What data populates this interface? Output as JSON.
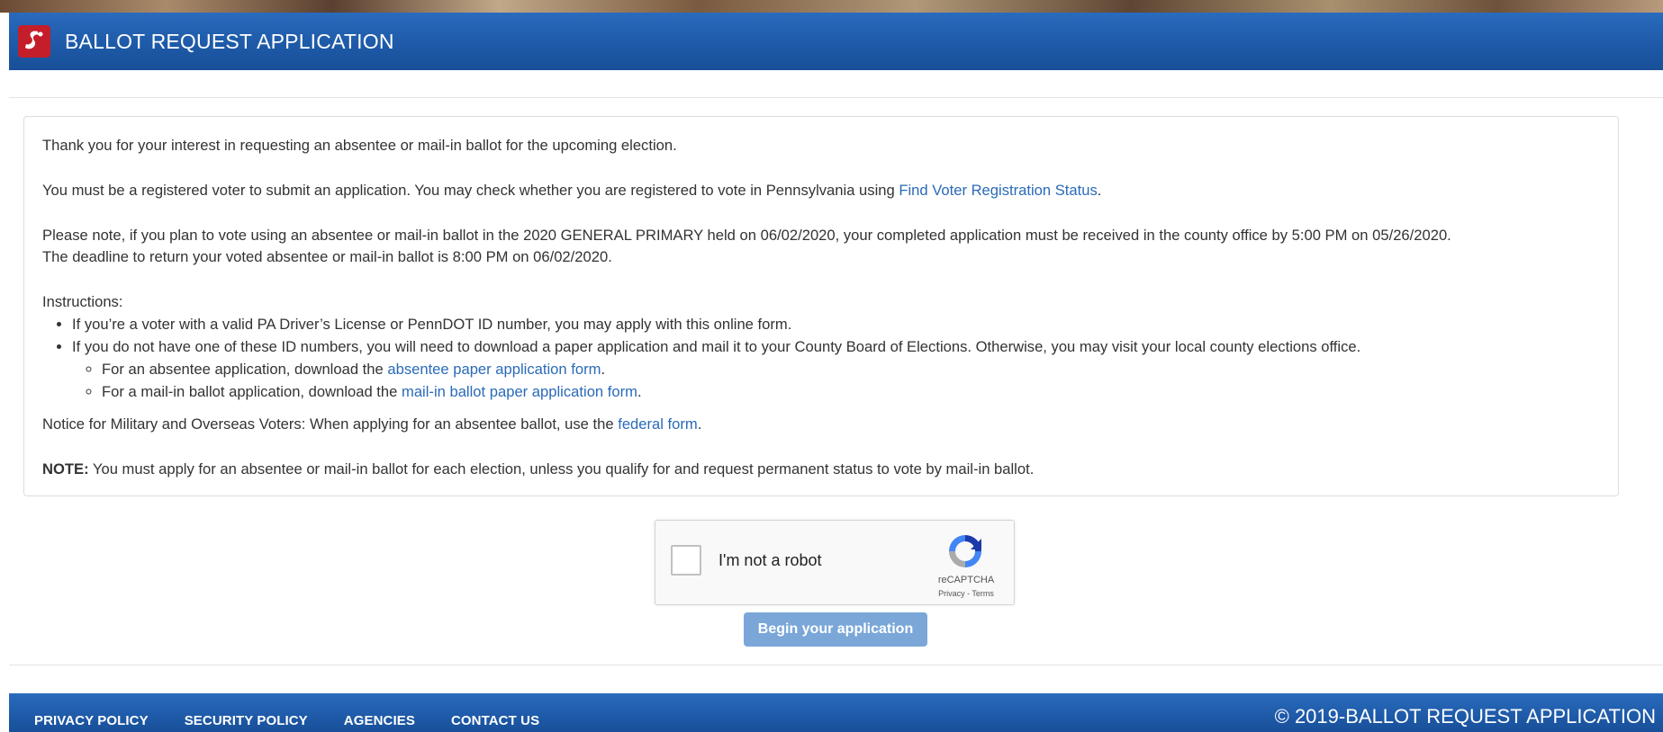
{
  "header": {
    "title": "BALLOT REQUEST APPLICATION"
  },
  "intro": {
    "thanks": "Thank you for your interest in requesting an absentee or mail-in ballot for the upcoming election.",
    "registered_prefix": "You must be a registered voter to submit an application. You may check whether you are registered to vote in Pennsylvania using ",
    "registered_link": "Find Voter Registration Status",
    "registered_suffix": ".",
    "deadline_line1": "Please note, if you plan to vote using an absentee or mail-in ballot in the 2020 GENERAL PRIMARY held on 06/02/2020, your completed application must be received in the county office by 5:00 PM on 05/26/2020.",
    "deadline_line2": "The deadline to return your voted absentee or mail-in ballot is 8:00 PM on 06/02/2020."
  },
  "instructions": {
    "heading": "Instructions:",
    "item1": "If you’re a voter with a valid PA Driver’s License or PennDOT ID number, you may apply with this online form.",
    "item2": "If you do not have one of these ID numbers, you will need to download a paper application and mail it to your County Board of Elections. Otherwise, you may visit your local county elections office.",
    "sub1_prefix": "For an absentee application, download the ",
    "sub1_link": "absentee paper application form",
    "sub1_suffix": ".",
    "sub2_prefix": "For a mail-in ballot application, download the ",
    "sub2_link": "mail-in ballot paper application form",
    "sub2_suffix": "."
  },
  "military": {
    "prefix": "Notice for Military and Overseas Voters: When applying for an absentee ballot, use the ",
    "link": "federal form",
    "suffix": "."
  },
  "note": {
    "label": "NOTE:",
    "text": " You must apply for an absentee or mail-in ballot for each election, unless you qualify for and request permanent status to vote by mail-in ballot."
  },
  "captcha": {
    "label": "I'm not a robot",
    "brand": "reCAPTCHA",
    "links": "Privacy - Terms"
  },
  "begin_button": "Begin your application",
  "footer": {
    "nav": [
      "PRIVACY POLICY",
      "SECURITY POLICY",
      "AGENCIES",
      "CONTACT US"
    ],
    "copyright": "© 2019-BALLOT REQUEST APPLICATION"
  },
  "colors": {
    "brand_blue": "#1e5aa8",
    "link_blue": "#2a6ab8",
    "button_blue": "#7aa7d8",
    "logo_red": "#c41e2a"
  }
}
